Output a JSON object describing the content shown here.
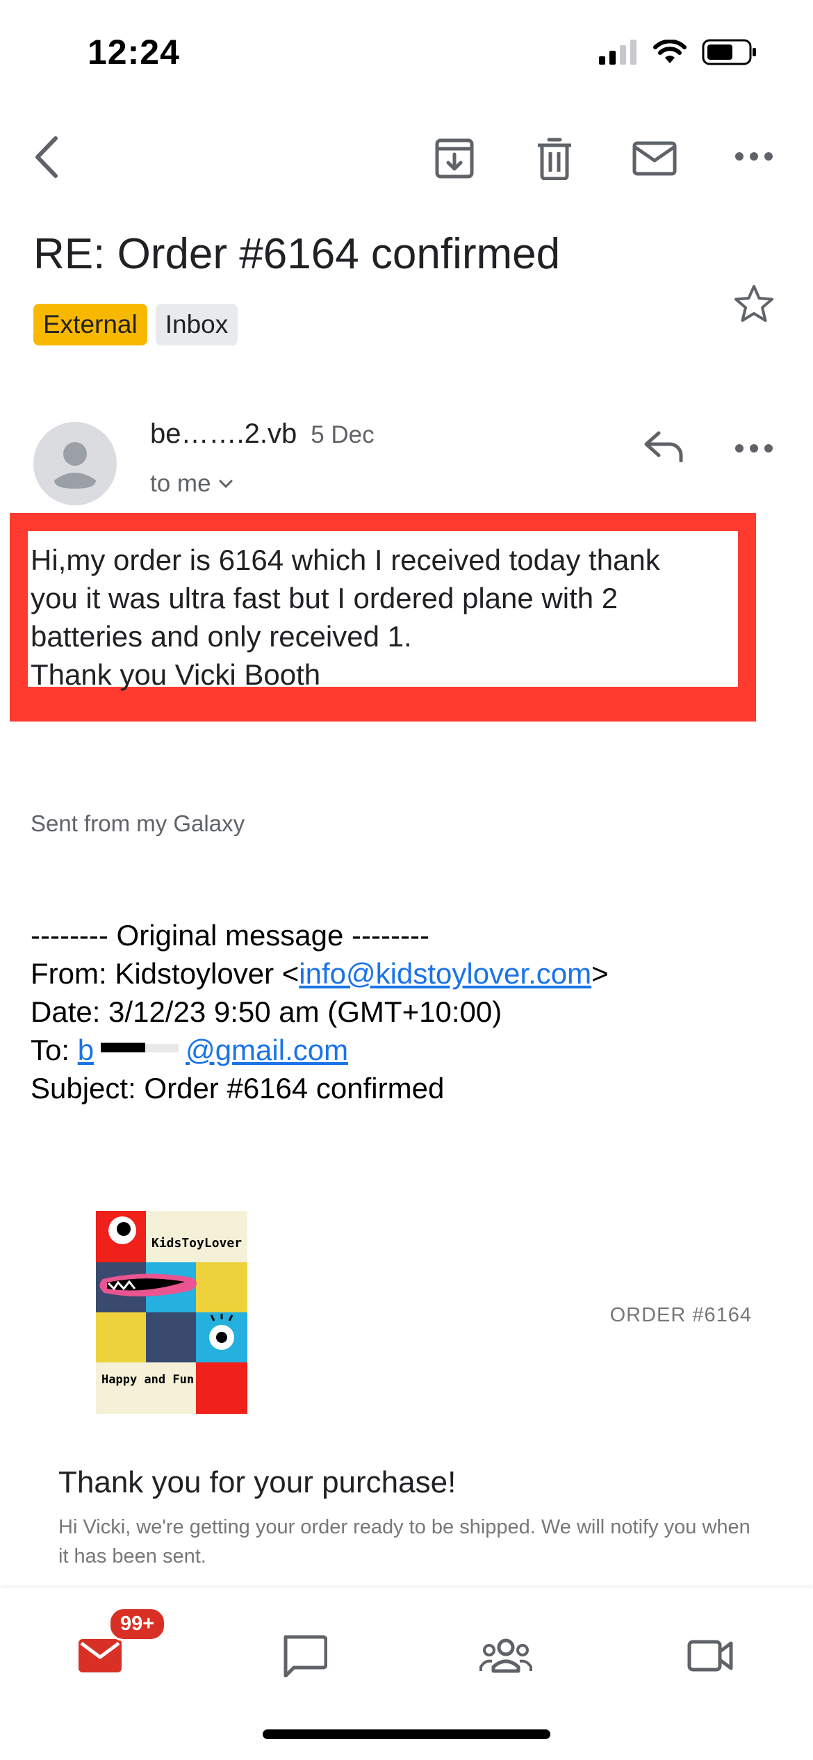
{
  "status_bar": {
    "time": "12:24"
  },
  "email": {
    "subject": "RE: Order #6164 confirmed",
    "labels": [
      "External",
      "Inbox"
    ],
    "sender": "be…….2.vb",
    "date": "5 Dec",
    "recipient": "to me",
    "body_lines": [
      "Hi,my order is 6164 which I received today thank",
      "you it was ultra fast but I ordered plane with 2",
      "batteries and only received 1.",
      "Thank you Vicki Booth"
    ],
    "signature": "Sent from my Galaxy",
    "original": {
      "separator": "-------- Original message --------",
      "from_label": "From: Kidstoylover <",
      "from_email": "info@kidstoylover.com",
      "from_close": ">",
      "date_line": "Date: 3/12/23 9:50 am (GMT+10:00)",
      "to_label": "To: ",
      "to_email_start": "b",
      "to_email_end": "@gmail.com",
      "subject_line": "Subject: Order #6164 confirmed"
    }
  },
  "store": {
    "logo_title": "KidsToyLover",
    "logo_tagline": "Happy and Fun",
    "order_number": "ORDER #6164",
    "thank_title": "Thank you for your purchase!",
    "thank_body": "Hi Vicki, we're getting your order ready to be shipped. We will notify you when it has been sent."
  },
  "nav": {
    "mail_badge": "99+"
  },
  "colors": {
    "accent_red": "#d93025",
    "highlight_red": "#ff3b30",
    "external_label": "#f9b800",
    "link_blue": "#1a73e8"
  }
}
